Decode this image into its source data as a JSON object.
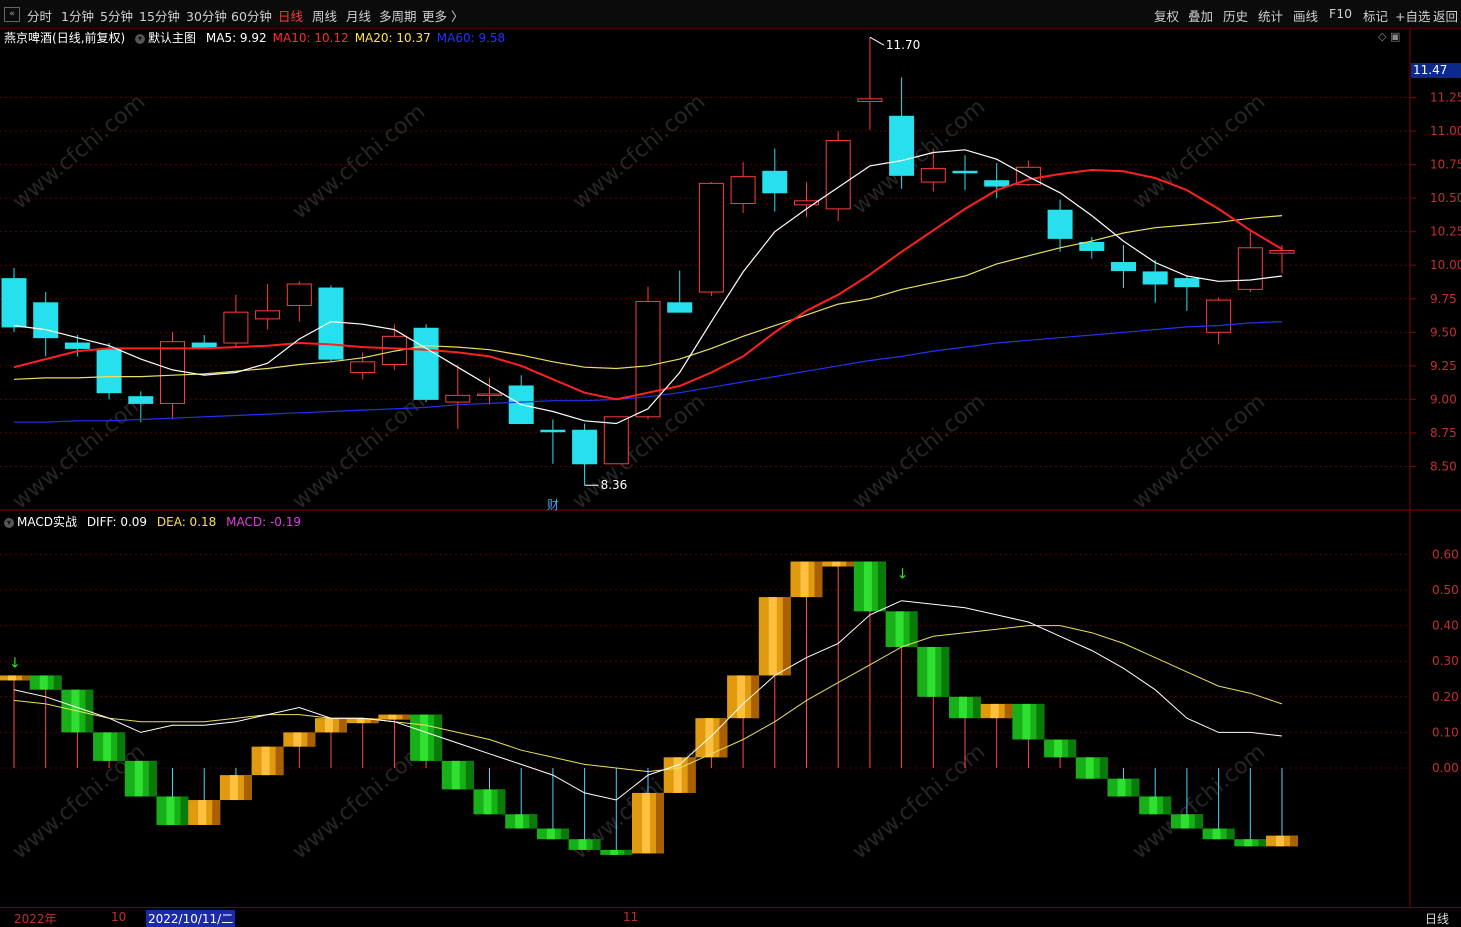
{
  "toolbar": {
    "toggle_icon": "sidebar-toggle-icon",
    "periods": [
      "分时",
      "1分钟",
      "5分钟",
      "15分钟",
      "30分钟",
      "60分钟",
      "日线",
      "周线",
      "月线",
      "多周期",
      "更多 〉"
    ],
    "active_period": "日线",
    "actions": [
      "复权",
      "叠加",
      "历史",
      "统计",
      "画线",
      "F10",
      "标记",
      "+自选",
      "返回"
    ]
  },
  "stock": {
    "name": "燕京啤酒",
    "mode": "(日线,前复权)",
    "template": "默认主图"
  },
  "ma_legend": [
    {
      "label": "MA5: 9.92",
      "color": "#ffffff"
    },
    {
      "label": "MA10: 10.12",
      "color": "#ff2b2b"
    },
    {
      "label": "MA20: 10.37",
      "color": "#ffe24a"
    },
    {
      "label": "MA60: 9.58",
      "color": "#2233ff"
    }
  ],
  "macd_legend": {
    "name": "MACD实战",
    "diff": "DIFF: 0.09",
    "dea": "DEA: 0.18",
    "macd": "MACD: -0.19",
    "diff_color": "#ffffff",
    "dea_color": "#ffe24a",
    "macd_color": "#e040e0"
  },
  "current_price_tag": "11.47",
  "date_axis": {
    "labels": [
      "2022年",
      "10",
      "11"
    ],
    "highlight": "2022/10/11/二",
    "period": "日线"
  },
  "watermark": "www.cfchi.com",
  "event_marker": "财",
  "colors": {
    "up": "#ff3b3b",
    "down": "#27e0ee",
    "ma5": "#ffffff",
    "ma10": "#ff2020",
    "ma20": "#e8e060",
    "ma60": "#2233ee",
    "grid": "#5a0000",
    "axis_text": "#c03030"
  },
  "chart_data": [
    {
      "type": "candlestick",
      "ylim": [
        8.25,
        11.47
      ],
      "yticks": [
        "11.25",
        "11.00",
        "10.75",
        "10.50",
        "10.25",
        "10.00",
        "9.75",
        "9.50",
        "9.25",
        "9.00",
        "8.75",
        "8.50"
      ],
      "annotations": [
        {
          "label": "11.70",
          "value": 11.7
        },
        {
          "label": "8.36",
          "value": 8.36
        }
      ],
      "candles": [
        {
          "o": 9.9,
          "h": 9.98,
          "l": 9.5,
          "c": 9.54
        },
        {
          "o": 9.72,
          "h": 9.8,
          "l": 9.32,
          "c": 9.46
        },
        {
          "o": 9.42,
          "h": 9.48,
          "l": 9.32,
          "c": 9.38
        },
        {
          "o": 9.37,
          "h": 9.42,
          "l": 9.0,
          "c": 9.05
        },
        {
          "o": 9.02,
          "h": 9.06,
          "l": 8.83,
          "c": 8.97
        },
        {
          "o": 8.97,
          "h": 9.5,
          "l": 8.85,
          "c": 9.43
        },
        {
          "o": 9.42,
          "h": 9.48,
          "l": 9.38,
          "c": 9.39
        },
        {
          "o": 9.42,
          "h": 9.78,
          "l": 9.38,
          "c": 9.65
        },
        {
          "o": 9.6,
          "h": 9.86,
          "l": 9.52,
          "c": 9.66
        },
        {
          "o": 9.7,
          "h": 9.88,
          "l": 9.58,
          "c": 9.86
        },
        {
          "o": 9.83,
          "h": 9.85,
          "l": 9.28,
          "c": 9.3
        },
        {
          "o": 9.2,
          "h": 9.35,
          "l": 9.15,
          "c": 9.28
        },
        {
          "o": 9.26,
          "h": 9.56,
          "l": 9.22,
          "c": 9.47
        },
        {
          "o": 9.53,
          "h": 9.56,
          "l": 8.98,
          "c": 9.0
        },
        {
          "o": 8.98,
          "h": 9.26,
          "l": 8.78,
          "c": 9.03
        },
        {
          "o": 9.04,
          "h": 9.16,
          "l": 8.96,
          "c": 9.04
        },
        {
          "o": 9.1,
          "h": 9.18,
          "l": 8.82,
          "c": 8.82
        },
        {
          "o": 8.77,
          "h": 8.85,
          "l": 8.52,
          "c": 8.76
        },
        {
          "o": 8.77,
          "h": 8.82,
          "l": 8.36,
          "c": 8.52
        },
        {
          "o": 8.52,
          "h": 8.87,
          "l": 8.52,
          "c": 8.87
        },
        {
          "o": 8.87,
          "h": 9.84,
          "l": 8.85,
          "c": 9.73
        },
        {
          "o": 9.72,
          "h": 9.96,
          "l": 9.65,
          "c": 9.65
        },
        {
          "o": 9.8,
          "h": 10.62,
          "l": 9.77,
          "c": 10.61
        },
        {
          "o": 10.46,
          "h": 10.77,
          "l": 10.39,
          "c": 10.66
        },
        {
          "o": 10.7,
          "h": 10.87,
          "l": 10.4,
          "c": 10.54
        },
        {
          "o": 10.45,
          "h": 10.62,
          "l": 10.36,
          "c": 10.48
        },
        {
          "o": 10.42,
          "h": 11.0,
          "l": 10.33,
          "c": 10.93
        },
        {
          "o": 11.22,
          "h": 11.7,
          "l": 11.01,
          "c": 11.24
        },
        {
          "o": 11.11,
          "h": 11.4,
          "l": 10.57,
          "c": 10.67
        },
        {
          "o": 10.62,
          "h": 10.87,
          "l": 10.55,
          "c": 10.72
        },
        {
          "o": 10.7,
          "h": 10.82,
          "l": 10.56,
          "c": 10.69
        },
        {
          "o": 10.63,
          "h": 10.76,
          "l": 10.5,
          "c": 10.59
        },
        {
          "o": 10.6,
          "h": 10.78,
          "l": 10.59,
          "c": 10.73
        },
        {
          "o": 10.41,
          "h": 10.49,
          "l": 10.1,
          "c": 10.2
        },
        {
          "o": 10.17,
          "h": 10.21,
          "l": 10.05,
          "c": 10.11
        },
        {
          "o": 10.02,
          "h": 10.15,
          "l": 9.83,
          "c": 9.96
        },
        {
          "o": 9.95,
          "h": 10.04,
          "l": 9.72,
          "c": 9.86
        },
        {
          "o": 9.9,
          "h": 9.92,
          "l": 9.66,
          "c": 9.84
        },
        {
          "o": 9.5,
          "h": 9.76,
          "l": 9.41,
          "c": 9.74
        },
        {
          "o": 9.82,
          "h": 10.26,
          "l": 9.8,
          "c": 10.13
        },
        {
          "o": 10.09,
          "h": 10.15,
          "l": 9.94,
          "c": 10.11
        }
      ],
      "ma5": [
        9.55,
        9.52,
        9.46,
        9.4,
        9.3,
        9.22,
        9.18,
        9.2,
        9.27,
        9.45,
        9.58,
        9.56,
        9.52,
        9.38,
        9.24,
        9.1,
        8.96,
        8.91,
        8.84,
        8.82,
        8.93,
        9.2,
        9.58,
        9.95,
        10.25,
        10.42,
        10.58,
        10.74,
        10.78,
        10.84,
        10.86,
        10.79,
        10.66,
        10.54,
        10.37,
        10.18,
        10.02,
        9.92,
        9.88,
        9.89,
        9.92
      ],
      "ma10": [
        9.24,
        9.3,
        9.36,
        9.38,
        9.38,
        9.38,
        9.38,
        9.39,
        9.4,
        9.42,
        9.41,
        9.39,
        9.38,
        9.37,
        9.35,
        9.32,
        9.25,
        9.15,
        9.05,
        9.0,
        9.05,
        9.1,
        9.2,
        9.32,
        9.5,
        9.66,
        9.78,
        9.93,
        10.1,
        10.26,
        10.42,
        10.56,
        10.64,
        10.68,
        10.71,
        10.7,
        10.65,
        10.56,
        10.42,
        10.26,
        10.12
      ],
      "ma20": [
        9.15,
        9.16,
        9.16,
        9.17,
        9.17,
        9.18,
        9.19,
        9.21,
        9.23,
        9.26,
        9.28,
        9.31,
        9.36,
        9.4,
        9.39,
        9.37,
        9.33,
        9.28,
        9.24,
        9.23,
        9.25,
        9.3,
        9.38,
        9.47,
        9.55,
        9.63,
        9.71,
        9.75,
        9.82,
        9.87,
        9.92,
        10.01,
        10.07,
        10.13,
        10.18,
        10.24,
        10.28,
        10.3,
        10.32,
        10.35,
        10.37
      ],
      "ma60": [
        8.83,
        8.83,
        8.84,
        8.84,
        8.85,
        8.86,
        8.87,
        8.88,
        8.89,
        8.9,
        8.91,
        8.92,
        8.93,
        8.94,
        8.96,
        8.97,
        8.98,
        8.99,
        8.99,
        9.0,
        9.02,
        9.05,
        9.09,
        9.13,
        9.17,
        9.21,
        9.25,
        9.29,
        9.32,
        9.36,
        9.39,
        9.42,
        9.44,
        9.46,
        9.48,
        9.5,
        9.52,
        9.54,
        9.55,
        9.57,
        9.58
      ]
    },
    {
      "type": "macd",
      "ylim": [
        -0.32,
        0.66
      ],
      "yticks": [
        "0.60",
        "0.50",
        "0.40",
        "0.30",
        "0.20",
        "0.10",
        "0.00"
      ],
      "diff": [
        0.22,
        0.2,
        0.17,
        0.14,
        0.1,
        0.12,
        0.12,
        0.13,
        0.15,
        0.17,
        0.14,
        0.14,
        0.13,
        0.1,
        0.07,
        0.04,
        0.01,
        -0.02,
        -0.07,
        -0.09,
        -0.02,
        0.01,
        0.09,
        0.18,
        0.26,
        0.31,
        0.35,
        0.43,
        0.47,
        0.46,
        0.45,
        0.43,
        0.41,
        0.37,
        0.33,
        0.28,
        0.22,
        0.14,
        0.1,
        0.1,
        0.09
      ],
      "dea": [
        0.19,
        0.18,
        0.16,
        0.14,
        0.13,
        0.13,
        0.13,
        0.14,
        0.15,
        0.15,
        0.14,
        0.14,
        0.13,
        0.12,
        0.1,
        0.08,
        0.05,
        0.03,
        0.01,
        0.0,
        -0.01,
        0.0,
        0.04,
        0.08,
        0.13,
        0.19,
        0.24,
        0.29,
        0.34,
        0.37,
        0.38,
        0.39,
        0.4,
        0.4,
        0.38,
        0.35,
        0.31,
        0.27,
        0.23,
        0.21,
        0.18
      ],
      "macd": [
        0.26,
        0.22,
        0.1,
        0.02,
        -0.08,
        -0.16,
        -0.09,
        -0.02,
        0.06,
        0.1,
        0.14,
        0.14,
        0.15,
        0.02,
        -0.06,
        -0.13,
        -0.17,
        -0.2,
        -0.23,
        -0.24,
        -0.07,
        0.03,
        0.14,
        0.26,
        0.48,
        0.58,
        0.58,
        0.44,
        0.34,
        0.2,
        0.14,
        0.18,
        0.08,
        0.03,
        -0.03,
        -0.08,
        -0.13,
        -0.17,
        -0.2,
        -0.22,
        -0.19
      ],
      "signals": [
        {
          "index": 0,
          "type": "sell"
        },
        {
          "index": 28,
          "type": "sell"
        }
      ]
    }
  ]
}
